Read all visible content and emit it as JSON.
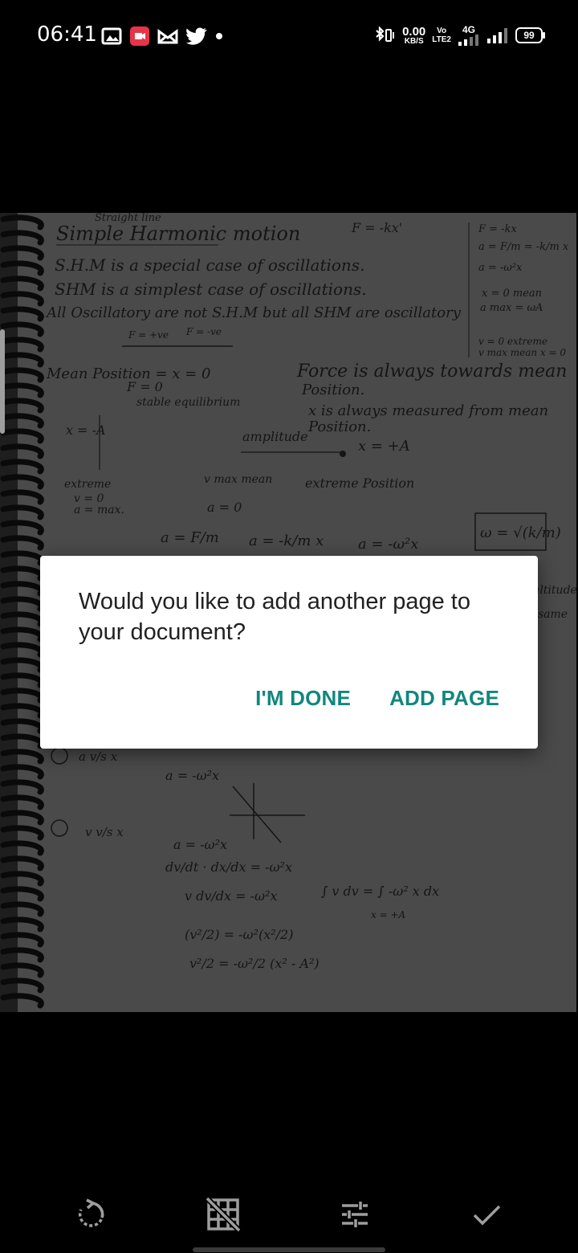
{
  "status": {
    "time": "06:41",
    "net_speed_value": "0.00",
    "net_speed_unit": "KB/S",
    "volte_top": "Vo",
    "volte_bottom": "LTE2",
    "network_type": "4G",
    "battery": "99",
    "left_icons": [
      "gallery-icon",
      "screen-record-icon",
      "mail-icon",
      "twitter-icon",
      "dot-icon"
    ],
    "right_icons": [
      "bluetooth-vibrate-icon",
      "signal-icon",
      "signal-icon"
    ]
  },
  "document": {
    "notes": {
      "title_small": "Straight line",
      "title": "Simple Harmonic motion",
      "formula_top": "F = -kx'",
      "line1": "S.H.M is a special case of oscillations.",
      "line2": "SHM is a simplest case of oscillations.",
      "line3": "All Oscillatory are not S.H.M but all SHM are oscillatory",
      "mean_position": "Mean Position = x = 0",
      "f0": "F = 0",
      "stable": "stable equilibrium",
      "force": "Force is always towards mean",
      "position": "Position.",
      "measured": "x is always measured from mean",
      "position2": "Position.",
      "amplitude": "amplitude",
      "x_minus_a": "x = -A",
      "x_plus_a": "x = +A",
      "extreme_left": "extreme",
      "v0": "v = 0",
      "amax": "a = max.",
      "vmax_mean": "v max mean",
      "a0": "a = 0",
      "extreme_position": "extreme Position",
      "a_f_m": "a = F/m",
      "a_kx_m": "a = -k/m x",
      "a_w2x": "a = -ω²x",
      "omega": "ω = √(k/m)",
      "side1": "F = -kx",
      "side2": "a = F/m = -k/m x",
      "side3": "a = -ω²x",
      "side4": "x = 0 mean",
      "side5": "a max = ωA",
      "side6": "v = 0 extreme",
      "side7": "v max mean x = 0",
      "altitude": "altitude",
      "same": "same",
      "item2": "a v/s x",
      "a_eq": "a = -ω²x",
      "item3": "v v/s x",
      "deriv1": "a = -ω²x",
      "deriv2": "dv/dt · dx/dx = -ω²x",
      "deriv3": "v dv/dx = -ω²x",
      "deriv4": "(v²/2) = -ω²(x²/2)",
      "deriv5": "v²/2 = -ω²/2 (x² - A²)",
      "integral": "∫ v dv = ∫ -ω² x dx",
      "x_eq_a": "x = +A"
    }
  },
  "dialog": {
    "message": "Would you like to add another page to your document?",
    "done_label": "I'M DONE",
    "add_label": "ADD PAGE"
  },
  "toolbar": {
    "icons": [
      "rotate-icon",
      "grid-off-icon",
      "adjust-icon",
      "check-icon"
    ]
  }
}
